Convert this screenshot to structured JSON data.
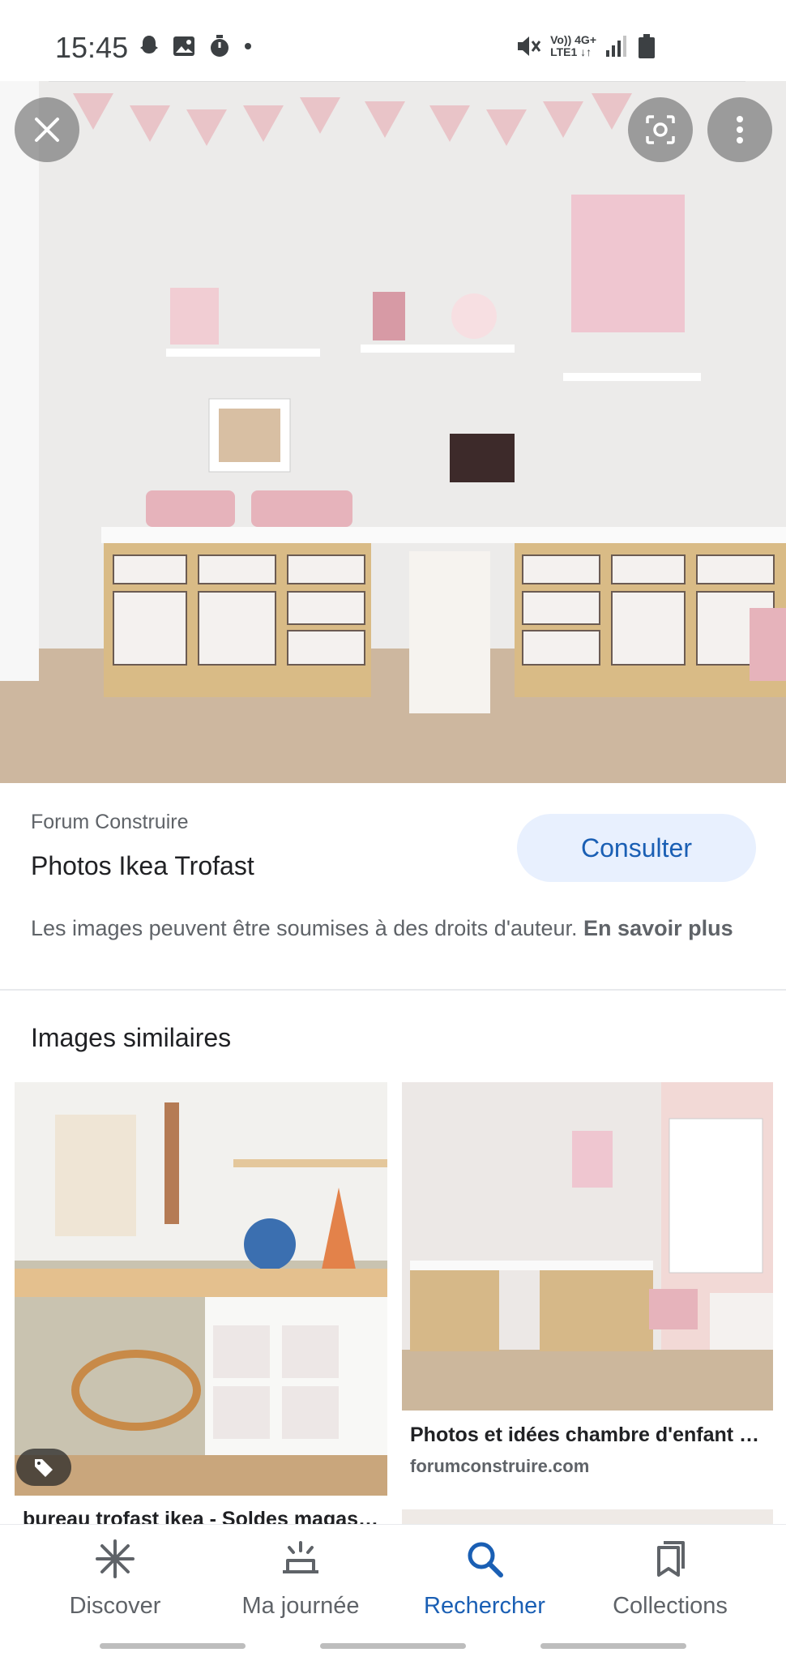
{
  "status_bar": {
    "time": "15:45",
    "network_line1": "Vo)) 4G+",
    "network_line2": "LTE1 ↓↑"
  },
  "result": {
    "source": "Forum Construire",
    "title": "Photos Ikea Trofast",
    "action_label": "Consulter",
    "copyright_text": "Les images peuvent être soumises à des droits d'auteur. ",
    "copyright_link": "En savoir plus"
  },
  "similar": {
    "heading": "Images similaires",
    "items": [
      {
        "caption": "bureau trofast ikea - Soldes magas…"
      },
      {
        "caption": "Photos et idées chambre d'enfant …",
        "domain": "forumconstruire.com"
      }
    ]
  },
  "nav": {
    "items": [
      {
        "label": "Discover",
        "icon": "asterisk-icon"
      },
      {
        "label": "Ma journée",
        "icon": "sunrise-icon"
      },
      {
        "label": "Rechercher",
        "icon": "search-icon",
        "active": true
      },
      {
        "label": "Collections",
        "icon": "bookmarks-icon"
      }
    ]
  },
  "colors": {
    "accent": "#1a5fb4",
    "button_bg": "#e8f0fe",
    "text_secondary": "#5f6368"
  }
}
